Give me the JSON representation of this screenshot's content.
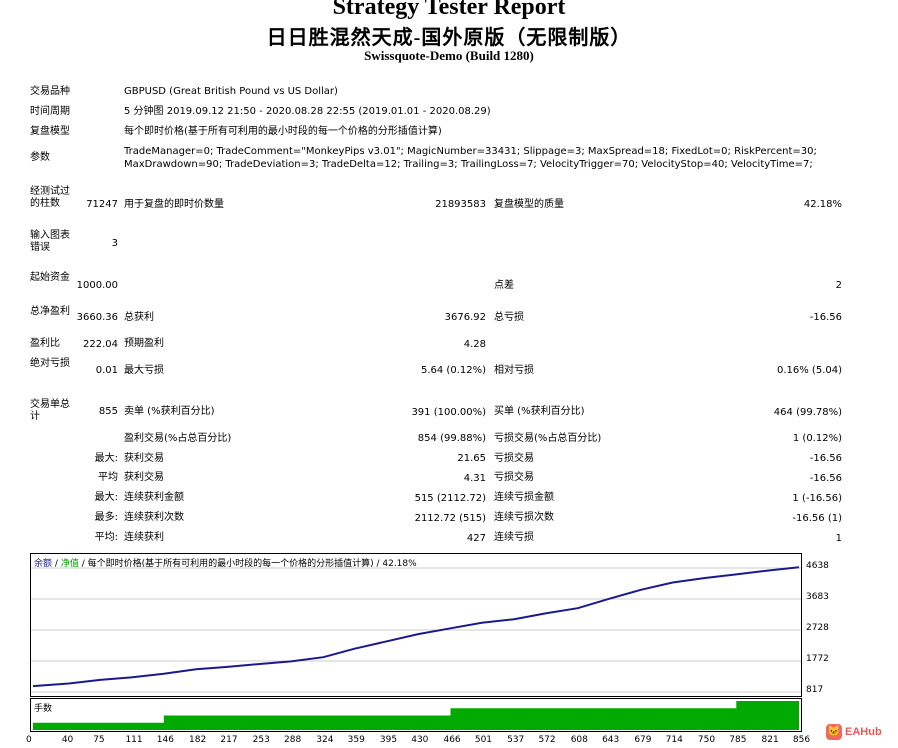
{
  "header": {
    "title": "Strategy Tester Report",
    "subtitle": "日日胜混然天成-国外原版（无限制版）",
    "server": "Swissquote-Demo (Build 1280)"
  },
  "info": {
    "symbol_label": "交易品种",
    "symbol_value": "GBPUSD (Great British Pound vs US Dollar)",
    "period_label": "时间周期",
    "period_value": "5 分钟图 2019.09.12 21:50 - 2020.08.28 22:55 (2019.01.01 - 2020.08.29)",
    "model_label": "复盘模型",
    "model_value": "每个即时价格(基于所有可利用的最小时段的每一个价格的分形插值计算)",
    "params_label": "参数",
    "params_line1": "TradeManager=0; TradeComment=\"MonkeyPips v3.01\"; MagicNumber=33431; Slippage=3; MaxSpread=18; FixedLot=0; RiskPercent=30;",
    "params_line2": "MaxDrawdown=90; TradeDeviation=3; TradeDelta=12; Trailing=3; TrailingLoss=7; VelocityTrigger=70; VelocityStop=40; VelocityTime=7;"
  },
  "stats": {
    "bars_label": "经测试过的柱数",
    "bars_value": "71247",
    "ticks_label": "用于复盘的即时价数量",
    "ticks_value": "21893583",
    "quality_label": "复盘模型的质量",
    "quality_value": "42.18%",
    "errors_label": "输入图表错误",
    "errors_value": "3",
    "deposit_label": "起始资金",
    "deposit_value": "1000.00",
    "spread_label": "点差",
    "spread_value": "2",
    "net_label": "总净盈利",
    "net_value": "3660.36",
    "gross_profit_label": "总获利",
    "gross_profit_value": "3676.92",
    "gross_loss_label": "总亏损",
    "gross_loss_value": "-16.56",
    "pf_label": "盈利比",
    "pf_value": "222.04",
    "payoff_label": "预期盈利",
    "payoff_value": "4.28",
    "abs_dd_label": "绝对亏损",
    "abs_dd_value": "0.01",
    "max_dd_label": "最大亏损",
    "max_dd_value": "5.64 (0.12%)",
    "rel_dd_label": "相对亏损",
    "rel_dd_value": "0.16% (5.04)",
    "trades_label": "交易单总计",
    "trades_value": "855",
    "short_label": "卖单 (%获利百分比)",
    "short_value": "391 (100.00%)",
    "long_label": "买单 (%获利百分比)",
    "long_value": "464 (99.78%)",
    "profit_trades_label": "盈利交易(%占总百分比)",
    "profit_trades_value": "854 (99.88%)",
    "loss_trades_label": "亏损交易(%占总百分比)",
    "loss_trades_value": "1 (0.12%)",
    "largest_label": "最大:",
    "largest_profit_label": "获利交易",
    "largest_profit_value": "21.65",
    "largest_loss_label": "亏损交易",
    "largest_loss_value": "-16.56",
    "average_label": "平均",
    "avg_profit_label": "获利交易",
    "avg_profit_value": "4.31",
    "avg_loss_label": "亏损交易",
    "avg_loss_value": "-16.56",
    "max_label": "最大:",
    "max_cons_wins_money_label": "连续获利金额",
    "max_cons_wins_money_value": "515 (2112.72)",
    "max_cons_loss_money_label": "连续亏损金额",
    "max_cons_loss_money_value": "1 (-16.56)",
    "most_label": "最多:",
    "max_cons_profit_count_label": "连续获利次数",
    "max_cons_profit_count_value": "2112.72 (515)",
    "max_cons_loss_count_label": "连续亏损次数",
    "max_cons_loss_count_value": "-16.56 (1)",
    "avg2_label": "平均:",
    "avg_cons_wins_label": "连续获利",
    "avg_cons_wins_value": "427",
    "avg_cons_loss_label": "连续亏损",
    "avg_cons_loss_value": "1"
  },
  "chart_legend": {
    "balance": "余额",
    "sep1": "/",
    "equity": "净值",
    "rest": "/ 每个即时价格(基于所有可利用的最小时段的每一个价格的分形插值计算) / 42.18%"
  },
  "lot_label": "手数",
  "watermark": "EAHub",
  "colors": {
    "balance_line": "#1a1a8c",
    "equity": "#00b000",
    "lots": "#00aa00"
  },
  "chart_data": {
    "type": "line",
    "y_ticks": [
      "4638",
      "3683",
      "2728",
      "1772",
      "817"
    ],
    "x_ticks": [
      "0",
      "40",
      "75",
      "111",
      "146",
      "182",
      "217",
      "253",
      "288",
      "324",
      "359",
      "395",
      "430",
      "466",
      "501",
      "537",
      "572",
      "608",
      "643",
      "679",
      "714",
      "750",
      "785",
      "821",
      "856"
    ],
    "ylim": [
      817,
      4638
    ],
    "xlim": [
      0,
      855
    ],
    "series": [
      {
        "name": "余额",
        "x": [
          0,
          40,
          75,
          111,
          146,
          182,
          217,
          253,
          288,
          324,
          359,
          395,
          430,
          466,
          501,
          537,
          572,
          608,
          643,
          679,
          714,
          750,
          785,
          821,
          855
        ],
        "values": [
          1000,
          1080,
          1190,
          1270,
          1380,
          1520,
          1590,
          1680,
          1760,
          1890,
          2150,
          2380,
          2600,
          2780,
          2950,
          3060,
          3240,
          3400,
          3690,
          3970,
          4190,
          4330,
          4440,
          4560,
          4660
        ]
      }
    ],
    "lots": {
      "x": [
        0,
        111,
        146,
        324,
        466,
        608,
        785,
        855
      ],
      "values": [
        1,
        1,
        2,
        2,
        3,
        3,
        4,
        4
      ],
      "max": 4
    }
  }
}
